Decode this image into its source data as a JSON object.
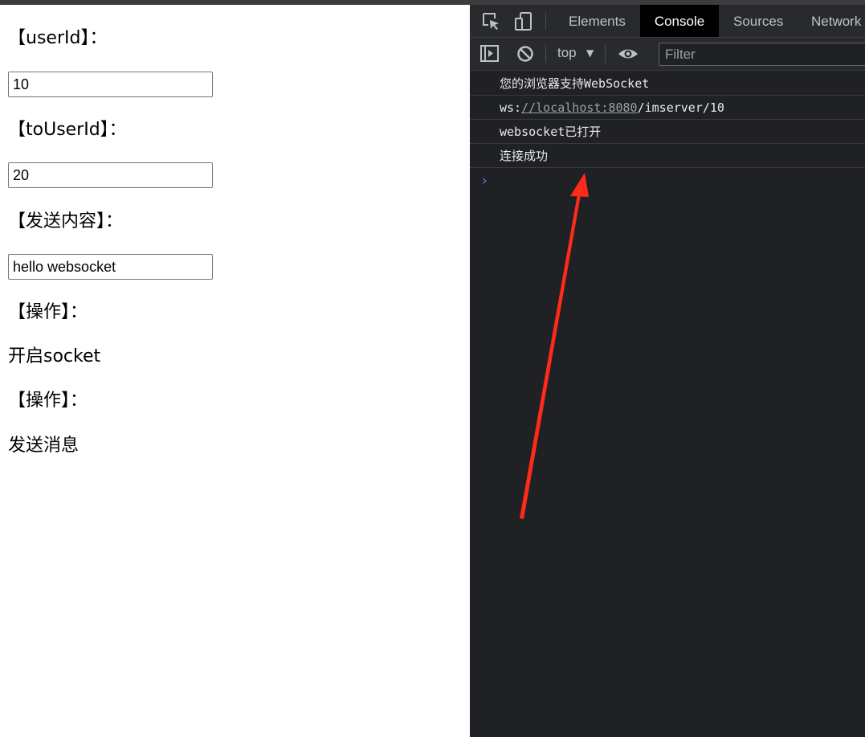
{
  "form": {
    "userid_label": "【userId】：",
    "userid_value": "10",
    "touserid_label": "【toUserId】：",
    "touserid_value": "20",
    "content_label": "【发送内容】：",
    "content_value": "hello websocket",
    "op_label_1": "【操作】：",
    "open_socket": "开启socket",
    "op_label_2": "【操作】：",
    "send_message": "发送消息"
  },
  "devtools": {
    "tabs": [
      {
        "label": "Elements",
        "active": false
      },
      {
        "label": "Console",
        "active": true
      },
      {
        "label": "Sources",
        "active": false
      },
      {
        "label": "Network",
        "active": false
      }
    ],
    "toolbar": {
      "context": "top",
      "filter_placeholder": "Filter"
    },
    "logs": [
      "您的浏览器支持WebSocket",
      {
        "prefix": "ws:",
        "link": "//localhost:8080",
        "suffix": "/imserver/10"
      },
      "websocket已打开",
      "连接成功"
    ],
    "prompt_symbol": "›"
  },
  "annotation": {
    "color": "#ff2a1a"
  }
}
